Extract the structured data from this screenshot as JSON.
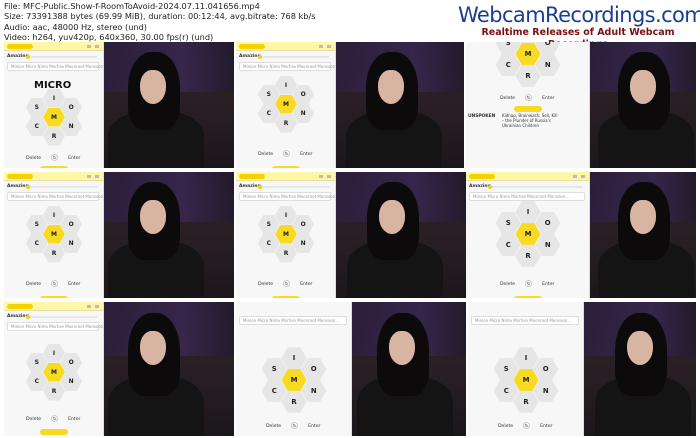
{
  "meta": {
    "file": "File: MFC-Public.Show-f-RoomToAvoid-2024.07.11.041656.mp4",
    "size": "Size: 73391388 bytes (69.99 MiB), duration: 00:12:44, avg.bitrate: 768 kb/s",
    "audio": "Audio: aac, 48000 Hz, stereo (und)",
    "video": "Video: h264, yuv420p, 640x360, 30.00 fps(r) (und)"
  },
  "brand": {
    "title": "WebcamRecordings.com",
    "subtitle": "Realtime Releases of Adult Webcam Recordings"
  },
  "game": {
    "center_letter": "M",
    "outer_letters": [
      "I",
      "O",
      "N",
      "C",
      "R",
      "S"
    ],
    "rank": "Amazing",
    "typed_word": "MICRO",
    "found_words": "Minion Micro Nimo Mortise Moonroot Monsoon...",
    "delete_label": "Delete",
    "enter_label": "Enter",
    "shuffle_icon": "shuffle-icon",
    "accent_color": "#f7da21"
  },
  "article": {
    "logo": "UNSPOKEN",
    "headline": "Kidnap, Brainwash, Sell, Kill – the Plunder of Russia's Ukrainian Children"
  }
}
